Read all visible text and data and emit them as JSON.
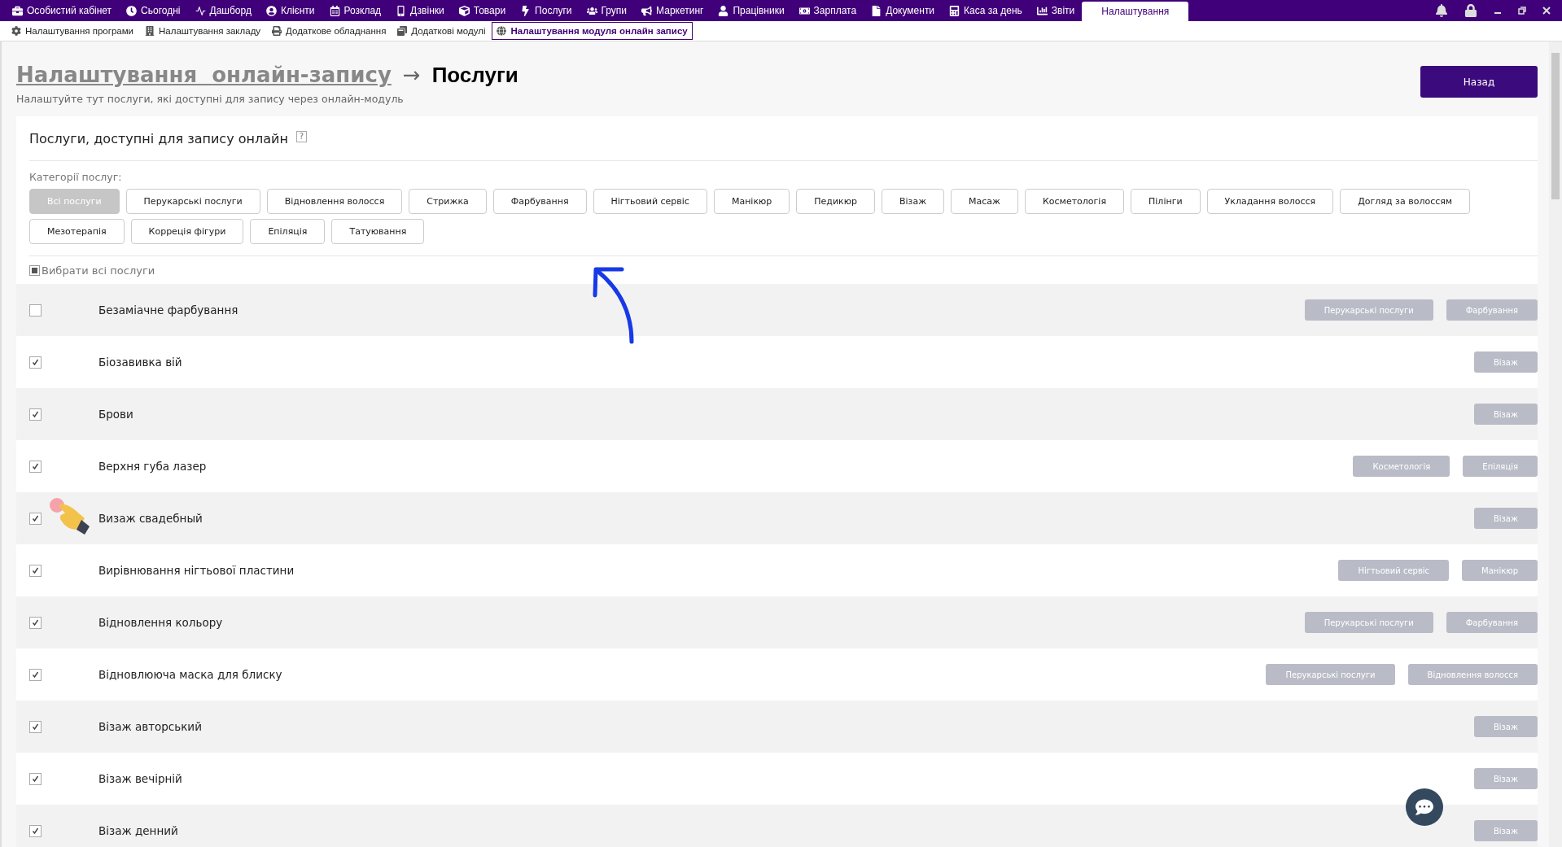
{
  "top_nav": [
    {
      "label": "Особистий кабінет",
      "selected": false
    },
    {
      "label": "Сьогодні",
      "selected": false
    },
    {
      "label": "Дашборд",
      "selected": false
    },
    {
      "label": "Клієнти",
      "selected": false
    },
    {
      "label": "Розклад",
      "selected": false
    },
    {
      "label": "Дзвінки",
      "selected": false
    },
    {
      "label": "Товари",
      "selected": false
    },
    {
      "label": "Послуги",
      "selected": false
    },
    {
      "label": "Групи",
      "selected": false
    },
    {
      "label": "Маркетинг",
      "selected": false
    },
    {
      "label": "Працівники",
      "selected": false
    },
    {
      "label": "Зарплата",
      "selected": false
    },
    {
      "label": "Документи",
      "selected": false
    },
    {
      "label": "Каса за день",
      "selected": false
    },
    {
      "label": "Звіти",
      "selected": false
    },
    {
      "label": "Налаштування",
      "selected": true
    }
  ],
  "sub_nav": [
    {
      "label": "Налаштування програми",
      "selected": false
    },
    {
      "label": "Налаштування закладу",
      "selected": false
    },
    {
      "label": "Додаткове обладнання",
      "selected": false
    },
    {
      "label": "Додаткові модулі",
      "selected": false
    },
    {
      "label": "Налаштування модуля онлайн запису",
      "selected": true
    }
  ],
  "header": {
    "breadcrumb_link": "Налаштування  онлайн-запису",
    "separator": "→",
    "title": "Послуги",
    "subtitle": "Налаштуйте тут послуги, які доступні для запису через онлайн-модуль",
    "back_button": "Назад"
  },
  "section": {
    "title": "Послуги, доступні для запису онлайн",
    "help": "?",
    "categories_label": "Категорії послуг:",
    "categories": [
      {
        "label": "Всі послуги",
        "selected": true
      },
      {
        "label": "Перукарські послуги",
        "selected": false
      },
      {
        "label": "Відновлення волосся",
        "selected": false
      },
      {
        "label": "Стрижка",
        "selected": false
      },
      {
        "label": "Фарбування",
        "selected": false
      },
      {
        "label": "Нігтьовий сервіс",
        "selected": false
      },
      {
        "label": "Манікюр",
        "selected": false
      },
      {
        "label": "Педикюр",
        "selected": false
      },
      {
        "label": "Візаж",
        "selected": false
      },
      {
        "label": "Масаж",
        "selected": false
      },
      {
        "label": "Косметологія",
        "selected": false
      },
      {
        "label": "Пілінги",
        "selected": false
      },
      {
        "label": "Укладання волосся",
        "selected": false
      },
      {
        "label": "Догляд за волоссям",
        "selected": false
      },
      {
        "label": "Мезотерапія",
        "selected": false
      },
      {
        "label": "Корреція фігури",
        "selected": false
      },
      {
        "label": "Епіляція",
        "selected": false
      },
      {
        "label": "Татуювання",
        "selected": false
      }
    ],
    "select_all": {
      "label": "Вибрати всі послуги",
      "indeterminate": true
    }
  },
  "services": [
    {
      "name": "Безаміачне фарбування",
      "checked": false,
      "tags": [
        "Перукарські послуги",
        "Фарбування"
      ]
    },
    {
      "name": "Біозавивка вій",
      "checked": true,
      "tags": [
        "Візаж"
      ]
    },
    {
      "name": "Брови",
      "checked": true,
      "tags": [
        "Візаж"
      ]
    },
    {
      "name": "Верхня губа лазер",
      "checked": true,
      "tags": [
        "Косметологія",
        "Епіляція"
      ]
    },
    {
      "name": "Визаж свадебный",
      "checked": true,
      "tags": [
        "Візаж"
      ]
    },
    {
      "name": "Вирівнювання нігтьової пластини",
      "checked": true,
      "tags": [
        "Нігтьовий сервіс",
        "Манікюр"
      ]
    },
    {
      "name": "Відновлення кольору",
      "checked": true,
      "tags": [
        "Перукарські послуги",
        "Фарбування"
      ]
    },
    {
      "name": "Відновлююча маска для блиску",
      "checked": true,
      "tags": [
        "Перукарські послуги",
        "Відновлення волосся"
      ]
    },
    {
      "name": "Візаж авторський",
      "checked": true,
      "tags": [
        "Візаж"
      ]
    },
    {
      "name": "Візаж вечірній",
      "checked": true,
      "tags": [
        "Візаж"
      ]
    },
    {
      "name": "Візаж денний",
      "checked": true,
      "tags": [
        "Візаж"
      ]
    }
  ]
}
